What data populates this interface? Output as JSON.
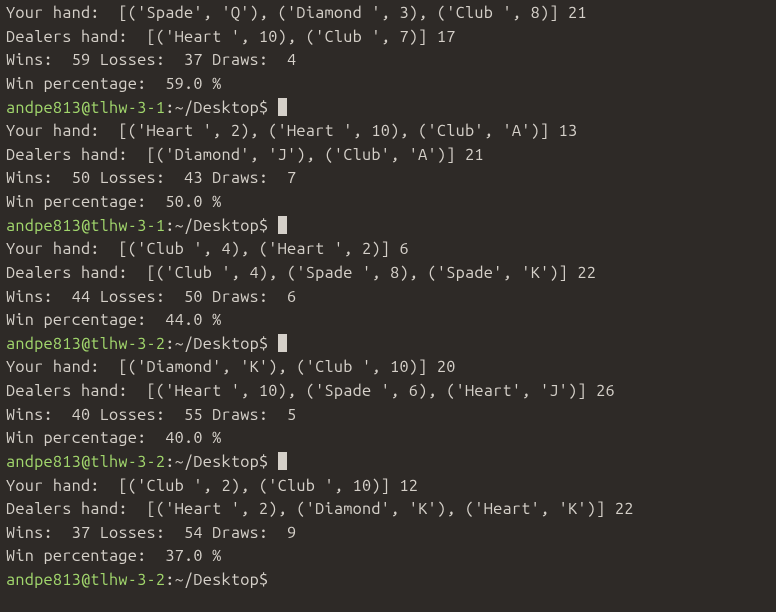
{
  "blocks": [
    {
      "your_hand": "Your hand:  [('Spade', 'Q'), ('Diamond ', 3), ('Club ', 8)] 21",
      "dealers_hand": "Dealers hand:  [('Heart ', 10), ('Club ', 7)] 17",
      "stats": "Wins:  59 Losses:  37 Draws:  4",
      "win_pct": "Win percentage:  59.0 %",
      "prompt_user": "andpe813@tlhw-3-1",
      "prompt_colon": ":",
      "prompt_path": "~/Desktop",
      "prompt_dollar": "$ ",
      "cursor": true
    },
    {
      "your_hand": "Your hand:  [('Heart ', 2), ('Heart ', 10), ('Club', 'A')] 13",
      "dealers_hand": "Dealers hand:  [('Diamond', 'J'), ('Club', 'A')] 21",
      "stats": "Wins:  50 Losses:  43 Draws:  7",
      "win_pct": "Win percentage:  50.0 %",
      "prompt_user": "andpe813@tlhw-3-1",
      "prompt_colon": ":",
      "prompt_path": "~/Desktop",
      "prompt_dollar": "$ ",
      "cursor": true
    },
    {
      "your_hand": "Your hand:  [('Club ', 4), ('Heart ', 2)] 6",
      "dealers_hand": "Dealers hand:  [('Club ', 4), ('Spade ', 8), ('Spade', 'K')] 22",
      "stats": "Wins:  44 Losses:  50 Draws:  6",
      "win_pct": "Win percentage:  44.0 %",
      "prompt_user": "andpe813@tlhw-3-2",
      "prompt_colon": ":",
      "prompt_path": "~/Desktop",
      "prompt_dollar": "$ ",
      "cursor": true
    },
    {
      "your_hand": "Your hand:  [('Diamond', 'K'), ('Club ', 10)] 20",
      "dealers_hand": "Dealers hand:  [('Heart ', 10), ('Spade ', 6), ('Heart', 'J')] 26",
      "stats": "Wins:  40 Losses:  55 Draws:  5",
      "win_pct": "Win percentage:  40.0 %",
      "prompt_user": "andpe813@tlhw-3-2",
      "prompt_colon": ":",
      "prompt_path": "~/Desktop",
      "prompt_dollar": "$ ",
      "cursor": true
    },
    {
      "your_hand": "Your hand:  [('Club ', 2), ('Club ', 10)] 12",
      "dealers_hand": "Dealers hand:  [('Heart ', 2), ('Diamond', 'K'), ('Heart', 'K')] 22",
      "stats": "Wins:  37 Losses:  54 Draws:  9",
      "win_pct": "Win percentage:  37.0 %",
      "prompt_user": "andpe813@tlhw-3-2",
      "prompt_colon": ":",
      "prompt_path": "~/Desktop",
      "prompt_dollar": "$ ",
      "cursor": false
    }
  ]
}
